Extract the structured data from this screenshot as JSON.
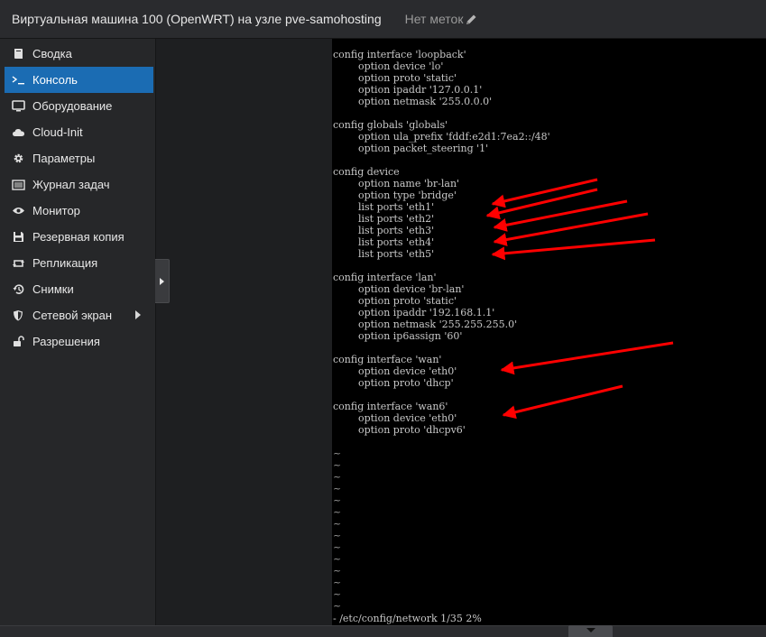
{
  "header": {
    "title": "Виртуальная машина 100 (OpenWRT) на узле pve-samohosting",
    "tags_label": "Нет меток",
    "icon": "pencil-icon"
  },
  "sidebar": {
    "items": [
      {
        "label": "Сводка",
        "icon": "book-icon"
      },
      {
        "label": "Консоль",
        "icon": "terminal-icon",
        "active": true
      },
      {
        "label": "Оборудование",
        "icon": "monitor-icon"
      },
      {
        "label": "Cloud-Init",
        "icon": "cloud-icon"
      },
      {
        "label": "Параметры",
        "icon": "gear-icon"
      },
      {
        "label": "Журнал задач",
        "icon": "list-icon"
      },
      {
        "label": "Монитор",
        "icon": "eye-icon"
      },
      {
        "label": "Резервная копия",
        "icon": "floppy-icon"
      },
      {
        "label": "Репликация",
        "icon": "retweet-icon"
      },
      {
        "label": "Снимки",
        "icon": "history-icon"
      },
      {
        "label": "Сетевой экран",
        "icon": "shield-icon",
        "has_submenu": true
      },
      {
        "label": "Разрешения",
        "icon": "unlock-icon"
      }
    ]
  },
  "terminal": {
    "lines": [
      {
        "row": 0,
        "text": "config interface 'loopback'"
      },
      {
        "row": 1,
        "text": "        option device 'lo'"
      },
      {
        "row": 2,
        "text": "        option proto 'static'"
      },
      {
        "row": 3,
        "text": "        option ipaddr '127.0.0.1'"
      },
      {
        "row": 4,
        "text": "        option netmask '255.0.0.0'"
      },
      {
        "row": 6,
        "text": "config globals 'globals'"
      },
      {
        "row": 7,
        "text": "        option ula_prefix 'fddf:e2d1:7ea2::/48'"
      },
      {
        "row": 8,
        "text": "        option packet_steering '1'"
      },
      {
        "row": 10,
        "text": "config device"
      },
      {
        "row": 11,
        "text": "        option name 'br-lan'"
      },
      {
        "row": 12,
        "text": "        option type 'bridge'"
      },
      {
        "row": 13,
        "text": "        list ports 'eth1'"
      },
      {
        "row": 14,
        "text": "        list ports 'eth2'"
      },
      {
        "row": 15,
        "text": "        list ports 'eth3'"
      },
      {
        "row": 16,
        "text": "        list ports 'eth4'"
      },
      {
        "row": 17,
        "text": "        list ports 'eth5'"
      },
      {
        "row": 19,
        "text": "config interface 'lan'"
      },
      {
        "row": 20,
        "text": "        option device 'br-lan'"
      },
      {
        "row": 21,
        "text": "        option proto 'static'"
      },
      {
        "row": 22,
        "text": "        option ipaddr '192.168.1.1'"
      },
      {
        "row": 23,
        "text": "        option netmask '255.255.255.0'"
      },
      {
        "row": 24,
        "text": "        option ip6assign '60'"
      },
      {
        "row": 26,
        "text": "config interface 'wan'"
      },
      {
        "row": 27,
        "text": "        option device 'eth0'"
      },
      {
        "row": 28,
        "text": "        option proto 'dhcp'"
      },
      {
        "row": 30,
        "text": "config interface 'wan6'"
      },
      {
        "row": 31,
        "text": "        option device 'eth0'"
      },
      {
        "row": 32,
        "text": "        option proto 'dhcpv6'"
      }
    ],
    "tilde_rows": [
      34,
      35,
      36,
      37,
      38,
      39,
      40,
      41,
      42,
      43,
      44,
      45,
      46,
      47
    ],
    "tilde_char": "~",
    "status_line": "- /etc/config/network 1/35 2%"
  },
  "annotation_color": "#ff0000"
}
